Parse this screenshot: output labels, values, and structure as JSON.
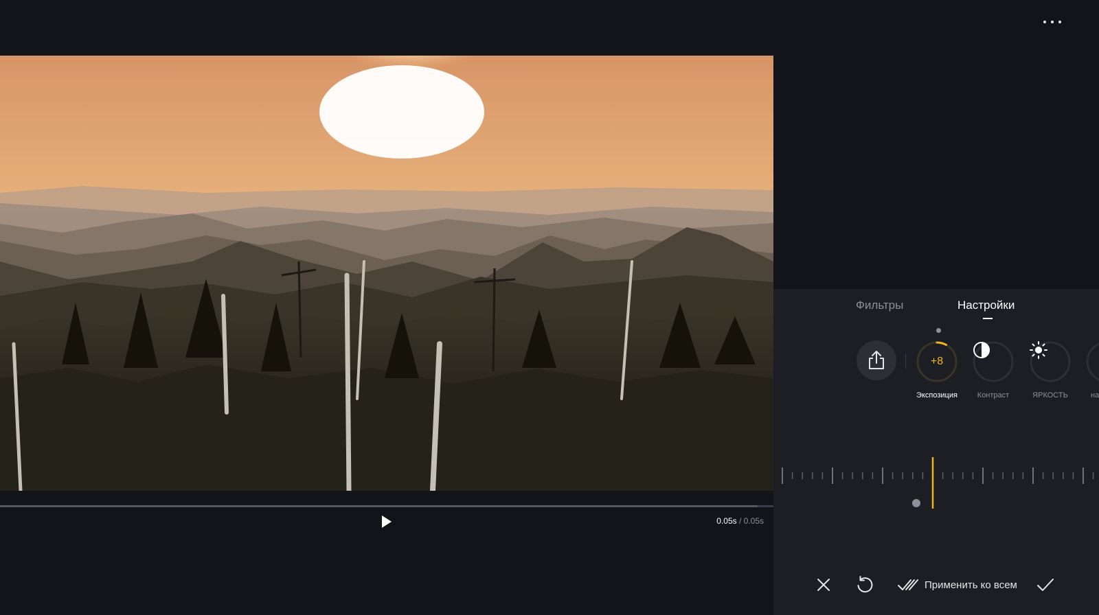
{
  "top_bar": {
    "more_icon": "more-horizontal-icon"
  },
  "preview": {
    "description_icon": "photo-preview"
  },
  "playback": {
    "play_icon": "play-icon",
    "current_time": "0.05s",
    "separator": " / ",
    "total_time": "0.05s",
    "progress": 0.98
  },
  "panel": {
    "tabs": [
      {
        "label": "Фильтры",
        "active": false
      },
      {
        "label": "Настройки",
        "active": true
      }
    ],
    "share_icon": "share-icon",
    "tools": [
      {
        "label": "Экспозиция",
        "value": "+8",
        "active": true,
        "level": 0.08
      },
      {
        "label": "Контраст",
        "icon": "contrast-icon",
        "active": false
      },
      {
        "label": "ЯРКОСТЬ",
        "icon": "brightness-icon",
        "active": false
      },
      {
        "label": "насыщ",
        "icon": "saturation-icon",
        "active": false
      }
    ],
    "slider": {
      "value": 8,
      "min": -100,
      "max": 100
    },
    "actions": {
      "cancel_icon": "close-icon",
      "reset_icon": "reset-icon",
      "apply_all_label": "Применить ко всем",
      "confirm_icon": "check-icon"
    },
    "accent_color": "#f3b41e"
  }
}
